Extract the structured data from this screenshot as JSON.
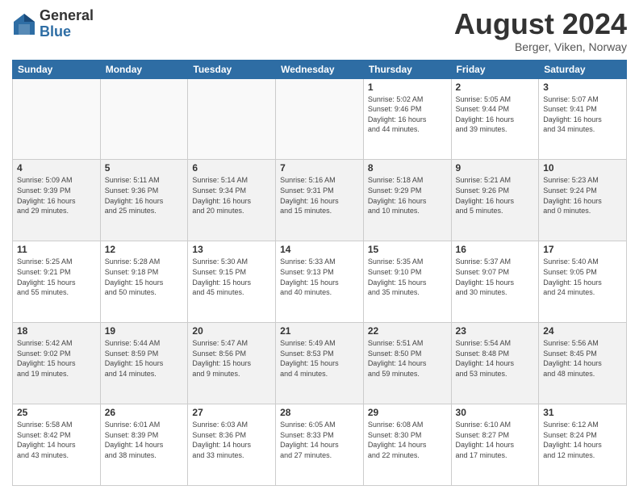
{
  "header": {
    "logo_general": "General",
    "logo_blue": "Blue",
    "month_title": "August 2024",
    "location": "Berger, Viken, Norway"
  },
  "days_of_week": [
    "Sunday",
    "Monday",
    "Tuesday",
    "Wednesday",
    "Thursday",
    "Friday",
    "Saturday"
  ],
  "weeks": [
    {
      "shade": false,
      "days": [
        {
          "num": "",
          "info": ""
        },
        {
          "num": "",
          "info": ""
        },
        {
          "num": "",
          "info": ""
        },
        {
          "num": "",
          "info": ""
        },
        {
          "num": "1",
          "info": "Sunrise: 5:02 AM\nSunset: 9:46 PM\nDaylight: 16 hours\nand 44 minutes."
        },
        {
          "num": "2",
          "info": "Sunrise: 5:05 AM\nSunset: 9:44 PM\nDaylight: 16 hours\nand 39 minutes."
        },
        {
          "num": "3",
          "info": "Sunrise: 5:07 AM\nSunset: 9:41 PM\nDaylight: 16 hours\nand 34 minutes."
        }
      ]
    },
    {
      "shade": true,
      "days": [
        {
          "num": "4",
          "info": "Sunrise: 5:09 AM\nSunset: 9:39 PM\nDaylight: 16 hours\nand 29 minutes."
        },
        {
          "num": "5",
          "info": "Sunrise: 5:11 AM\nSunset: 9:36 PM\nDaylight: 16 hours\nand 25 minutes."
        },
        {
          "num": "6",
          "info": "Sunrise: 5:14 AM\nSunset: 9:34 PM\nDaylight: 16 hours\nand 20 minutes."
        },
        {
          "num": "7",
          "info": "Sunrise: 5:16 AM\nSunset: 9:31 PM\nDaylight: 16 hours\nand 15 minutes."
        },
        {
          "num": "8",
          "info": "Sunrise: 5:18 AM\nSunset: 9:29 PM\nDaylight: 16 hours\nand 10 minutes."
        },
        {
          "num": "9",
          "info": "Sunrise: 5:21 AM\nSunset: 9:26 PM\nDaylight: 16 hours\nand 5 minutes."
        },
        {
          "num": "10",
          "info": "Sunrise: 5:23 AM\nSunset: 9:24 PM\nDaylight: 16 hours\nand 0 minutes."
        }
      ]
    },
    {
      "shade": false,
      "days": [
        {
          "num": "11",
          "info": "Sunrise: 5:25 AM\nSunset: 9:21 PM\nDaylight: 15 hours\nand 55 minutes."
        },
        {
          "num": "12",
          "info": "Sunrise: 5:28 AM\nSunset: 9:18 PM\nDaylight: 15 hours\nand 50 minutes."
        },
        {
          "num": "13",
          "info": "Sunrise: 5:30 AM\nSunset: 9:15 PM\nDaylight: 15 hours\nand 45 minutes."
        },
        {
          "num": "14",
          "info": "Sunrise: 5:33 AM\nSunset: 9:13 PM\nDaylight: 15 hours\nand 40 minutes."
        },
        {
          "num": "15",
          "info": "Sunrise: 5:35 AM\nSunset: 9:10 PM\nDaylight: 15 hours\nand 35 minutes."
        },
        {
          "num": "16",
          "info": "Sunrise: 5:37 AM\nSunset: 9:07 PM\nDaylight: 15 hours\nand 30 minutes."
        },
        {
          "num": "17",
          "info": "Sunrise: 5:40 AM\nSunset: 9:05 PM\nDaylight: 15 hours\nand 24 minutes."
        }
      ]
    },
    {
      "shade": true,
      "days": [
        {
          "num": "18",
          "info": "Sunrise: 5:42 AM\nSunset: 9:02 PM\nDaylight: 15 hours\nand 19 minutes."
        },
        {
          "num": "19",
          "info": "Sunrise: 5:44 AM\nSunset: 8:59 PM\nDaylight: 15 hours\nand 14 minutes."
        },
        {
          "num": "20",
          "info": "Sunrise: 5:47 AM\nSunset: 8:56 PM\nDaylight: 15 hours\nand 9 minutes."
        },
        {
          "num": "21",
          "info": "Sunrise: 5:49 AM\nSunset: 8:53 PM\nDaylight: 15 hours\nand 4 minutes."
        },
        {
          "num": "22",
          "info": "Sunrise: 5:51 AM\nSunset: 8:50 PM\nDaylight: 14 hours\nand 59 minutes."
        },
        {
          "num": "23",
          "info": "Sunrise: 5:54 AM\nSunset: 8:48 PM\nDaylight: 14 hours\nand 53 minutes."
        },
        {
          "num": "24",
          "info": "Sunrise: 5:56 AM\nSunset: 8:45 PM\nDaylight: 14 hours\nand 48 minutes."
        }
      ]
    },
    {
      "shade": false,
      "days": [
        {
          "num": "25",
          "info": "Sunrise: 5:58 AM\nSunset: 8:42 PM\nDaylight: 14 hours\nand 43 minutes."
        },
        {
          "num": "26",
          "info": "Sunrise: 6:01 AM\nSunset: 8:39 PM\nDaylight: 14 hours\nand 38 minutes."
        },
        {
          "num": "27",
          "info": "Sunrise: 6:03 AM\nSunset: 8:36 PM\nDaylight: 14 hours\nand 33 minutes."
        },
        {
          "num": "28",
          "info": "Sunrise: 6:05 AM\nSunset: 8:33 PM\nDaylight: 14 hours\nand 27 minutes."
        },
        {
          "num": "29",
          "info": "Sunrise: 6:08 AM\nSunset: 8:30 PM\nDaylight: 14 hours\nand 22 minutes."
        },
        {
          "num": "30",
          "info": "Sunrise: 6:10 AM\nSunset: 8:27 PM\nDaylight: 14 hours\nand 17 minutes."
        },
        {
          "num": "31",
          "info": "Sunrise: 6:12 AM\nSunset: 8:24 PM\nDaylight: 14 hours\nand 12 minutes."
        }
      ]
    }
  ]
}
